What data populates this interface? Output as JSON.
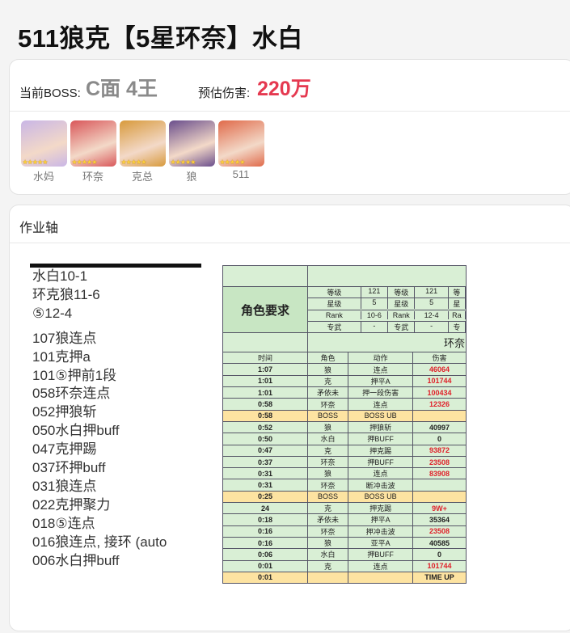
{
  "page": {
    "title": "511狼克【5星环奈】水白"
  },
  "boss_info": {
    "boss_label": "当前BOSS:",
    "boss_value": "C面 4王",
    "damage_label": "预估伤害:",
    "damage_value": "220万"
  },
  "characters": [
    {
      "name": "水妈",
      "stars": "★★★★★",
      "color": "#c9b6e6"
    },
    {
      "name": "环奈",
      "stars": "★★★★★",
      "color": "#d9575a"
    },
    {
      "name": "克总",
      "stars": "★★★★★",
      "color": "#d89a3c"
    },
    {
      "name": "狼",
      "stars": "★★★★★",
      "color": "#6a4e8c"
    },
    {
      "name": "511",
      "stars": "★★★★★",
      "color": "#e06a4a"
    }
  ],
  "axis": {
    "title": "作业轴",
    "notes": [
      "水白10-1",
      "环克狼11-6",
      "⑤12-4",
      "",
      "107狼连点",
      "101克押a",
      "101⑤押前1段",
      "058环奈连点",
      "052押狼斩",
      "050水白押buff",
      "047克押踢",
      "037环押buff",
      "031狼连点",
      "022克押聚力",
      "018⑤连点",
      "016狼连点, 接环 (auto",
      "006水白押buff"
    ],
    "sheet": {
      "role_req": "角色要求",
      "attr_labels": [
        "等级",
        "星级",
        "Rank",
        "专武"
      ],
      "col1_vals": [
        "121",
        "5",
        "10-6",
        "-"
      ],
      "col2_vals": [
        "121",
        "5",
        "12-4",
        "-"
      ],
      "col3_vals": [
        "等",
        "星",
        "Ra",
        "专"
      ],
      "right_title": "环奈",
      "headers": [
        "时间",
        "角色",
        "动作",
        "伤害"
      ],
      "rows": [
        {
          "t": "1:07",
          "c": "狼",
          "a": "连点",
          "d": "46064",
          "red": true,
          "boss": false
        },
        {
          "t": "1:01",
          "c": "克",
          "a": "押平A",
          "d": "101744",
          "red": true,
          "boss": false
        },
        {
          "t": "1:01",
          "c": "矛依未",
          "a": "押一段伤害",
          "d": "100434",
          "red": true,
          "boss": false
        },
        {
          "t": "0:58",
          "c": "环奈",
          "a": "连点",
          "d": "12326",
          "red": true,
          "boss": false
        },
        {
          "t": "0:58",
          "c": "BOSS",
          "a": "BOSS UB",
          "d": "",
          "red": false,
          "boss": true
        },
        {
          "t": "0:52",
          "c": "狼",
          "a": "押狼斩",
          "d": "40997",
          "red": false,
          "boss": false
        },
        {
          "t": "0:50",
          "c": "水白",
          "a": "押BUFF",
          "d": "0",
          "red": false,
          "boss": false
        },
        {
          "t": "0:47",
          "c": "克",
          "a": "押克踢",
          "d": "93872",
          "red": true,
          "boss": false
        },
        {
          "t": "0:37",
          "c": "环奈",
          "a": "押BUFF",
          "d": "23508",
          "red": true,
          "boss": false
        },
        {
          "t": "0:31",
          "c": "狼",
          "a": "连点",
          "d": "83908",
          "red": true,
          "boss": false
        },
        {
          "t": "0:31",
          "c": "环奈",
          "a": "断冲击波",
          "d": "",
          "red": false,
          "boss": false
        },
        {
          "t": "0:25",
          "c": "BOSS",
          "a": "BOSS UB",
          "d": "",
          "red": false,
          "boss": true
        },
        {
          "t": "24",
          "c": "克",
          "a": "押克踢",
          "d": "9W+",
          "red": true,
          "boss": false
        },
        {
          "t": "0:18",
          "c": "矛依未",
          "a": "押平A",
          "d": "35364",
          "red": false,
          "boss": false
        },
        {
          "t": "0:16",
          "c": "环奈",
          "a": "押冲击波",
          "d": "23508",
          "red": true,
          "boss": false
        },
        {
          "t": "0:16",
          "c": "狼",
          "a": "亚平A",
          "d": "40585",
          "red": false,
          "boss": false
        },
        {
          "t": "0:06",
          "c": "水白",
          "a": "押BUFF",
          "d": "0",
          "red": false,
          "boss": false
        },
        {
          "t": "0:01",
          "c": "克",
          "a": "连点",
          "d": "101744",
          "red": true,
          "boss": false
        },
        {
          "t": "0:01",
          "c": "",
          "a": "",
          "d": "TIME UP",
          "red": false,
          "boss": true
        }
      ]
    }
  }
}
